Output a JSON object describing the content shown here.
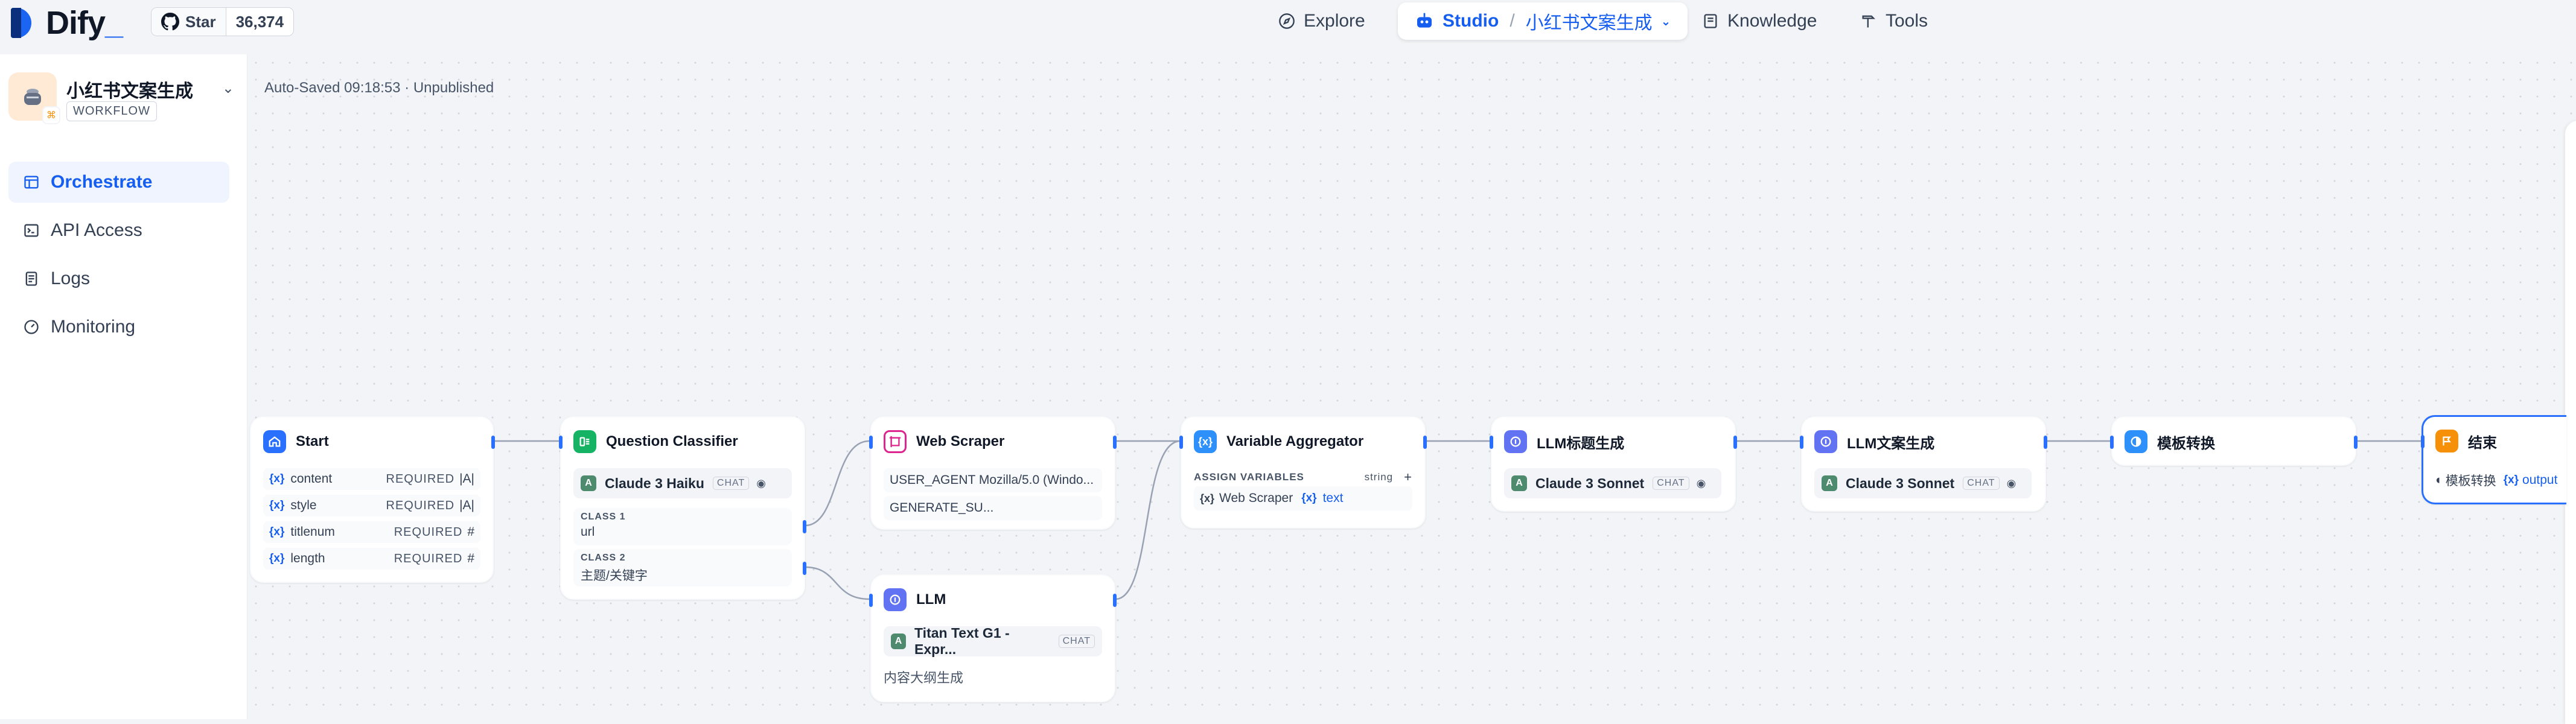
{
  "header": {
    "logo_text": "Dify",
    "star_label": "Star",
    "star_count": "36,374",
    "nav": {
      "explore": "Explore",
      "studio": "Studio",
      "app_name": "小红书文案生成",
      "knowledge": "Knowledge",
      "tools": "Tools"
    },
    "separator": "/"
  },
  "sidebar": {
    "app_name": "小红书文案生成",
    "app_type": "WORKFLOW",
    "items": [
      {
        "label": "Orchestrate",
        "active": true
      },
      {
        "label": "API Access",
        "active": false
      },
      {
        "label": "Logs",
        "active": false
      },
      {
        "label": "Monitoring",
        "active": false
      }
    ]
  },
  "canvas": {
    "status": "Auto-Saved 09:18:53 · Unpublished"
  },
  "nodes": {
    "start": {
      "title": "Start",
      "vars": [
        {
          "name": "content",
          "req": "REQUIRED",
          "type": "|A|"
        },
        {
          "name": "style",
          "req": "REQUIRED",
          "type": "|A|"
        },
        {
          "name": "titlenum",
          "req": "REQUIRED",
          "type": "#"
        },
        {
          "name": "length",
          "req": "REQUIRED",
          "type": "#"
        }
      ]
    },
    "classifier": {
      "title": "Question Classifier",
      "model": "Claude 3 Haiku",
      "model_tag": "CHAT",
      "classes": [
        {
          "label": "CLASS 1",
          "value": "url"
        },
        {
          "label": "CLASS 2",
          "value": "主题/关键字"
        }
      ]
    },
    "scraper": {
      "title": "Web Scraper",
      "rows": [
        "USER_AGENT Mozilla/5.0 (Windo...",
        "GENERATE_SU..."
      ]
    },
    "llm": {
      "title": "LLM",
      "model": "Titan Text G1 - Expr...",
      "model_tag": "CHAT",
      "note": "内容大纲生成"
    },
    "aggregator": {
      "title": "Variable Aggregator",
      "assign_label": "ASSIGN VARIABLES",
      "type": "string",
      "plus": "+",
      "source": "Web Scraper",
      "var": "text"
    },
    "llm_title": {
      "title": "LLM标题生成",
      "model": "Claude 3 Sonnet",
      "model_tag": "CHAT"
    },
    "llm_copy": {
      "title": "LLM文案生成",
      "model": "Claude 3 Sonnet",
      "model_tag": "CHAT"
    },
    "template": {
      "title": "模板转换"
    },
    "end": {
      "title": "结束",
      "source": "模板转换",
      "var": "output"
    }
  },
  "colors": {
    "accent": "#155eef",
    "start_icon": "#2970ff",
    "classifier_icon": "#16b364",
    "scraper_icon": "#dd2590",
    "aggregator_icon": "#2e90fa",
    "llm_icon": "#6172f3",
    "template_icon": "#2e90fa",
    "end_icon": "#f79009"
  }
}
